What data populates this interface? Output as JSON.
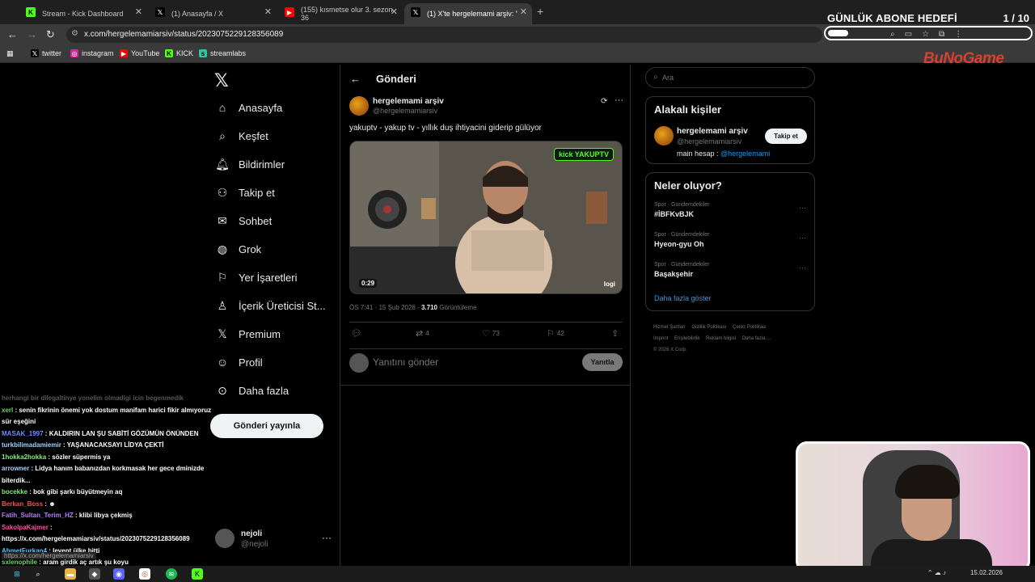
{
  "browser": {
    "tabs": [
      {
        "label": "Stream - Kick Dashboard",
        "icon": "kick-icon",
        "active": false
      },
      {
        "label": "(1) Anasayfa / X",
        "icon": "x-icon",
        "active": false
      },
      {
        "label": "(155) kısmetse olur 3. sezon 36",
        "icon": "youtube-icon",
        "active": false
      },
      {
        "label": "(1) X'te hergelemami arşiv: \"yak",
        "icon": "x-icon",
        "active": true
      }
    ],
    "url": "x.com/hergelemamiarsiv/status/2023075229128356089",
    "bookmarks": [
      "twitter",
      "instagram",
      "YouTube",
      "KICK",
      "streamlabs"
    ]
  },
  "overlay": {
    "goal_title": "GÜNLÜK ABONE HEDEFİ",
    "goal_count": "1 / 10",
    "goal_progress": 0.1,
    "brand": "BuNoGame"
  },
  "x": {
    "nav": [
      {
        "label": "Anasayfa",
        "icon": "home-icon"
      },
      {
        "label": "Keşfet",
        "icon": "search-icon"
      },
      {
        "label": "Bildirimler",
        "icon": "bell-icon"
      },
      {
        "label": "Takip et",
        "icon": "follow-icon"
      },
      {
        "label": "Sohbet",
        "icon": "mail-icon"
      },
      {
        "label": "Grok",
        "icon": "grok-icon"
      },
      {
        "label": "Yer İşaretleri",
        "icon": "bookmark-icon"
      },
      {
        "label": "İçerik Üreticisi St...",
        "icon": "creator-icon"
      },
      {
        "label": "Premium",
        "icon": "x-premium-icon"
      },
      {
        "label": "Profil",
        "icon": "profile-icon"
      },
      {
        "label": "Daha fazla",
        "icon": "more-circle-icon"
      }
    ],
    "post_button": "Gönderi yayınla",
    "me": {
      "name": "nejoli",
      "handle": "@nejoli"
    },
    "main": {
      "header": "Gönderi",
      "author_name": "hergelemami arşiv",
      "author_handle": "@hergelemamiarsiv",
      "text": "yakuptv - yakup tv - yıllık duş ihtiyacini giderip gülüyor",
      "video_duration": "0:29",
      "video_watermark": "logi",
      "video_overlay": "kick YAKUPTV",
      "time": "ÖS 7:41 · 15 Şub 2026 ·",
      "views": "3.710",
      "views_label": "Görüntüleme",
      "reposts": "4",
      "likes": "73",
      "bookmarks": "42",
      "reply_placeholder": "Yanıtını gönder",
      "reply_button": "Yanıtla"
    },
    "sidebar": {
      "search_placeholder": "Ara",
      "related_title": "Alakalı kişiler",
      "related": {
        "name": "hergelemami arşiv",
        "handle": "@hergelemamiarsiv",
        "follow": "Takip et",
        "bio_prefix": "main hesap : ",
        "bio_link": "@hergelemami"
      },
      "trends_title": "Neler oluyor?",
      "trends": [
        {
          "category": "Spor · Gündemdekiler",
          "title": "#İBFKvBJK"
        },
        {
          "category": "Spor · Gündemdekiler",
          "title": "Hyeon-gyu Oh"
        },
        {
          "category": "Spor · Gündemdekiler",
          "title": "Başakşehir"
        }
      ],
      "show_more": "Daha fazla göster",
      "footer": [
        "Hizmet Şartları",
        "Gizlilik Politikası",
        "Çerez Politikası",
        "Imprint",
        "Erişilebilirlik",
        "Reklam bilgisi",
        "Daha fazla ...",
        "© 2026 X Corp."
      ]
    }
  },
  "chat": [
    {
      "user": "",
      "text": "herhangi bir dilegaltinye yonelim olmadigi icin begenmedik",
      "color": "#555555",
      "faded": true
    },
    {
      "user": "xerl",
      "text": "senin fikrinin önemi yok dostum manifam harici fikir almıyoruz sür eşeğini",
      "color": "#6bd66b"
    },
    {
      "user": "MASAK_1997",
      "text": "KALDIRIN LAN ŞU SABİTİ GÖZÜMÜN ÖNÜNDEN",
      "color": "#6b8cff"
    },
    {
      "user": "turkbilimadamiemir",
      "text": "YAŞANACAKSAYI LİDYA ÇEKTİ",
      "color": "#9fd3ff"
    },
    {
      "user": "1hokka2hokka",
      "text": "sözler süpermis ya",
      "color": "#7cf07c"
    },
    {
      "user": "arrowner",
      "text": "Lidya hanım babanızdan korkmasak her gece dminizde biterdik...",
      "color": "#9fd3ff"
    },
    {
      "user": "bocekke",
      "text": "bok gibi şarkı büyütmeyin aq",
      "color": "#7cf07c"
    },
    {
      "user": "Berkan_Boss",
      "text": "☻",
      "color": "#ff4d4d"
    },
    {
      "user": "Fatih_Sultan_Terim_HZ",
      "text": "klibi libya çekmiş",
      "color": "#b57cff"
    },
    {
      "user": "SakolpaKajmer",
      "text": "https://x.com/hergelemamiarsiv/status/2023075229128356089",
      "color": "#ff4da6"
    },
    {
      "user": "AhmetFurkan4",
      "text": "levent ülke bitti",
      "color": "#57c7ff"
    },
    {
      "user": "sxlenophile",
      "text": "aram girdik aç artık şu koyu",
      "color": "#6bd66b"
    }
  ],
  "url_tooltip": "https://x.com/hergelemamiarsiv",
  "taskbar": {
    "date": "15.02.2026"
  }
}
